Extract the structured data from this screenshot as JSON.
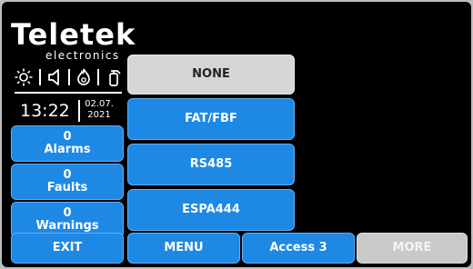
{
  "branding": {
    "logo": "Teletek",
    "logo_sub": "electronics"
  },
  "status_icons": [
    "sun-icon",
    "speaker-icon",
    "flame-icon",
    "extinguisher-icon"
  ],
  "clock": {
    "time": "13:22",
    "date_day": "02.07.",
    "date_year": "2021"
  },
  "counters": {
    "alarms": {
      "count": "0",
      "label": "Alarms"
    },
    "faults": {
      "count": "0",
      "label": "Faults"
    },
    "warnings": {
      "count": "0",
      "label": "Warnings"
    }
  },
  "options": [
    "NONE",
    "FAT/FBF",
    "RS485",
    "ESPA444"
  ],
  "bottom_bar": {
    "exit": "EXIT",
    "menu": "MENU",
    "access": "Access 3",
    "more": "MORE"
  },
  "colors": {
    "button_blue": "#1e88e5",
    "selected_gray": "#d6d6d6",
    "disabled_gray": "#c9c9c9"
  }
}
